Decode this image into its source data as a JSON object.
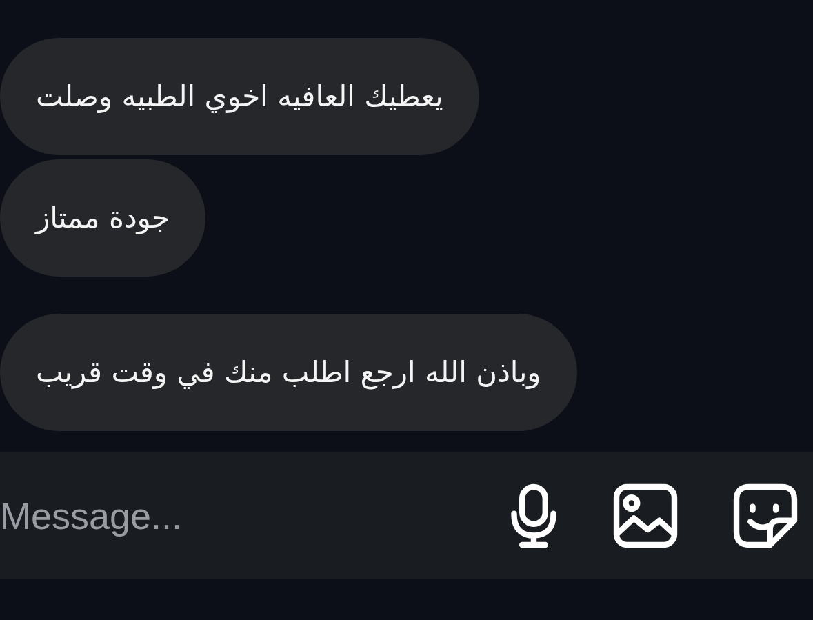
{
  "messages": [
    {
      "text": "يعطيك العافيه اخوي الطبيه وصلت"
    },
    {
      "text": "جودة ممتاز"
    },
    {
      "text": "وباذن الله ارجع اطلب منك في وقت قريب"
    }
  ],
  "composer": {
    "placeholder": "Message..."
  }
}
